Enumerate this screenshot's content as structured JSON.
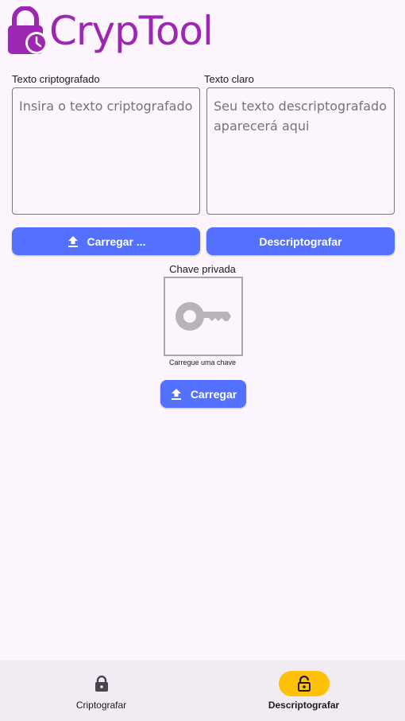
{
  "app": {
    "title": "CrypTool",
    "accent": "#9c27b0",
    "primary": "#5470ff",
    "nav_active": "#ffc107"
  },
  "encrypted": {
    "label": "Texto criptografado",
    "placeholder": "Insira o texto criptografado"
  },
  "plain": {
    "label": "Texto claro",
    "placeholder": "Seu texto descriptografado aparecerá aqui"
  },
  "buttons": {
    "load_text": "Carregar ...",
    "decrypt": "Descriptografar",
    "load_key": "Carregar"
  },
  "key": {
    "label": "Chave privada",
    "hint": "Carregue uma chave",
    "icon": "key-icon"
  },
  "nav": {
    "items": [
      {
        "label": "Criptografar",
        "icon": "lock-icon",
        "active": false
      },
      {
        "label": "Descriptografar",
        "icon": "lock-open-icon",
        "active": true
      }
    ]
  }
}
